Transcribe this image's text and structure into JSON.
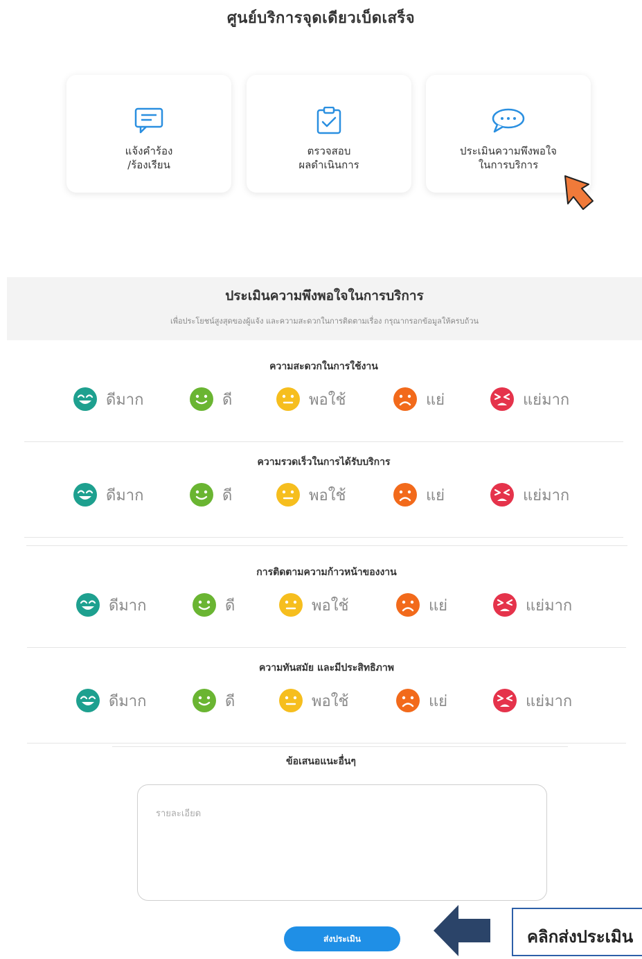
{
  "page": {
    "title": "ศูนย์บริการจุดเดียวเบ็ดเสร็จ"
  },
  "cards": [
    {
      "label": "แจ้งคำร้อง\n/ร้องเรียน",
      "icon": "message-square-icon"
    },
    {
      "label": "ตรวจสอบ\nผลดำเนินการ",
      "icon": "clipboard-check-icon"
    },
    {
      "label": "ประเมินความพึงพอใจ\nในการบริการ",
      "icon": "chat-bubble-icon"
    }
  ],
  "survey": {
    "title": "ประเมินความพึงพอใจในการบริการ",
    "subtitle": "เพื่อประโยชน์สูงสุดของผู้แจ้ง และความสะดวกในการติดตามเรื่อง กรุณากรอกข้อมูลให้ครบถ้วน",
    "ratings": [
      "ดีมาก",
      "ดี",
      "พอใช้",
      "แย่",
      "แย่มาก"
    ],
    "rating_colors": [
      "#1ea08f",
      "#6ab532",
      "#f6be1e",
      "#f26a1b",
      "#e5334b"
    ],
    "questions": [
      "ความสะดวกในการใช้งาน",
      "ความรวดเร็วในการได้รับบริการ",
      "การติดตามความก้าวหน้าของงาน",
      "ความทันสมัย และมีประสิทธิภาพ"
    ],
    "suggestion_title": "ข้อเสนอแนะอื่นๆ",
    "suggestion_placeholder": "รายละเอียด",
    "submit_label": "ส่งประเมิน"
  },
  "annotation": {
    "callout_text": "คลิกส่งประเมิน",
    "arrow_color": "#f07a3a",
    "arrow_left_color": "#2b4469"
  }
}
